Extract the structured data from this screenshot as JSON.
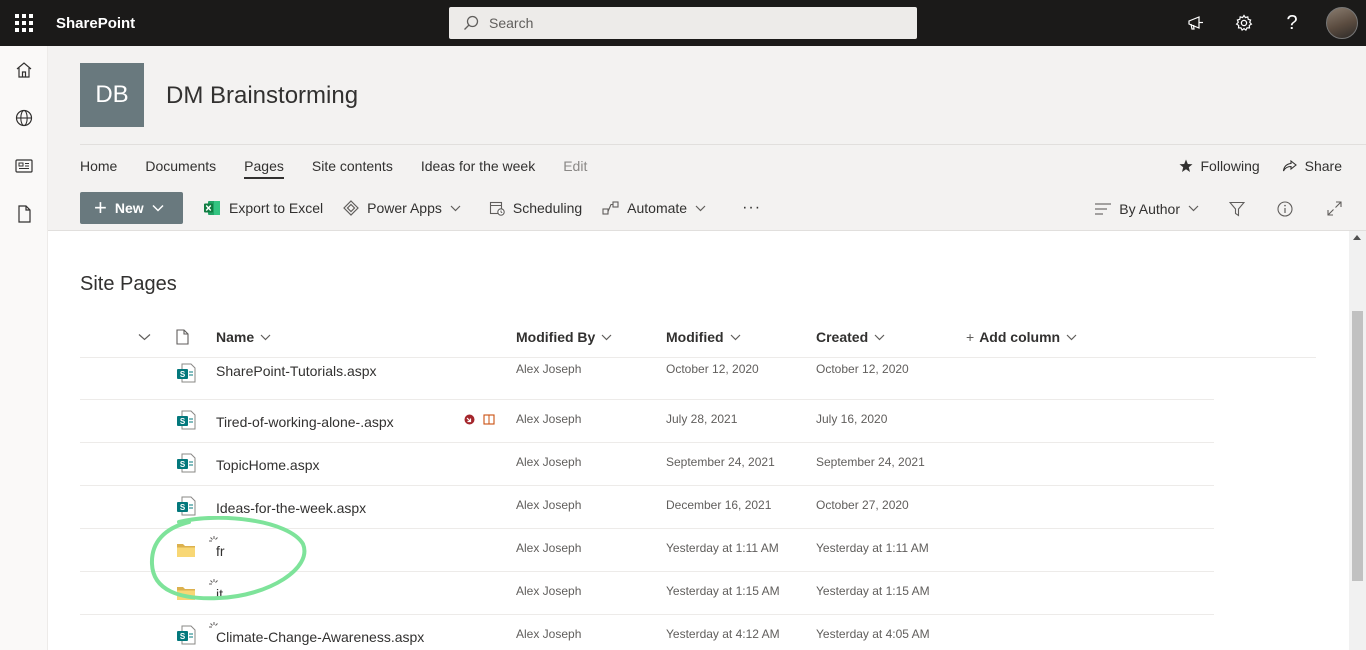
{
  "suite": {
    "app_name": "SharePoint",
    "search_placeholder": "Search"
  },
  "site": {
    "logo_initials": "DB",
    "title": "DM Brainstorming",
    "logo_color": "#69797e"
  },
  "nav": {
    "items": [
      "Home",
      "Documents",
      "Pages",
      "Site contents",
      "Ideas for the week"
    ],
    "active": "Pages",
    "edit_label": "Edit",
    "following_label": "Following",
    "share_label": "Share"
  },
  "commands": {
    "new_label": "New",
    "export_label": "Export to Excel",
    "powerapps_label": "Power Apps",
    "scheduling_label": "Scheduling",
    "automate_label": "Automate",
    "more_label": "···",
    "view_label": "By Author"
  },
  "list": {
    "title": "Site Pages",
    "columns": {
      "name": "Name",
      "modified_by": "Modified By",
      "modified": "Modified",
      "created": "Created",
      "add_column": "Add column"
    },
    "rows": [
      {
        "type": "page",
        "name": "SharePoint-Tutorials.aspx",
        "modified_by": "Alex Joseph",
        "modified": "October 12, 2020",
        "created": "October 12, 2020"
      },
      {
        "type": "page",
        "name": "Tired-of-working-alone-.aspx",
        "modified_by": "Alex Joseph",
        "modified": "July 28, 2021",
        "created": "July 16, 2020"
      },
      {
        "type": "page",
        "name": "TopicHome.aspx",
        "modified_by": "Alex Joseph",
        "modified": "September 24, 2021",
        "created": "September 24, 2021"
      },
      {
        "type": "page",
        "name": "Ideas-for-the-week.aspx",
        "modified_by": "Alex Joseph",
        "modified": "December 16, 2021",
        "created": "October 27, 2020"
      },
      {
        "type": "folder",
        "name": "fr",
        "modified_by": "Alex Joseph",
        "modified": "Yesterday at 1:11 AM",
        "created": "Yesterday at 1:11 AM"
      },
      {
        "type": "folder",
        "name": "it",
        "modified_by": "Alex Joseph",
        "modified": "Yesterday at 1:15 AM",
        "created": "Yesterday at 1:15 AM"
      },
      {
        "type": "page",
        "name": "Climate-Change-Awareness.aspx",
        "modified_by": "Alex Joseph",
        "modified": "Yesterday at 4:12 AM",
        "created": "Yesterday at 4:05 AM"
      }
    ]
  },
  "colors": {
    "suitebar": "#1b1a19",
    "header_bg": "#f3f2f1",
    "folder": "#f8d775",
    "sp_green": "#03787c",
    "highlight": "#7ee39a"
  }
}
